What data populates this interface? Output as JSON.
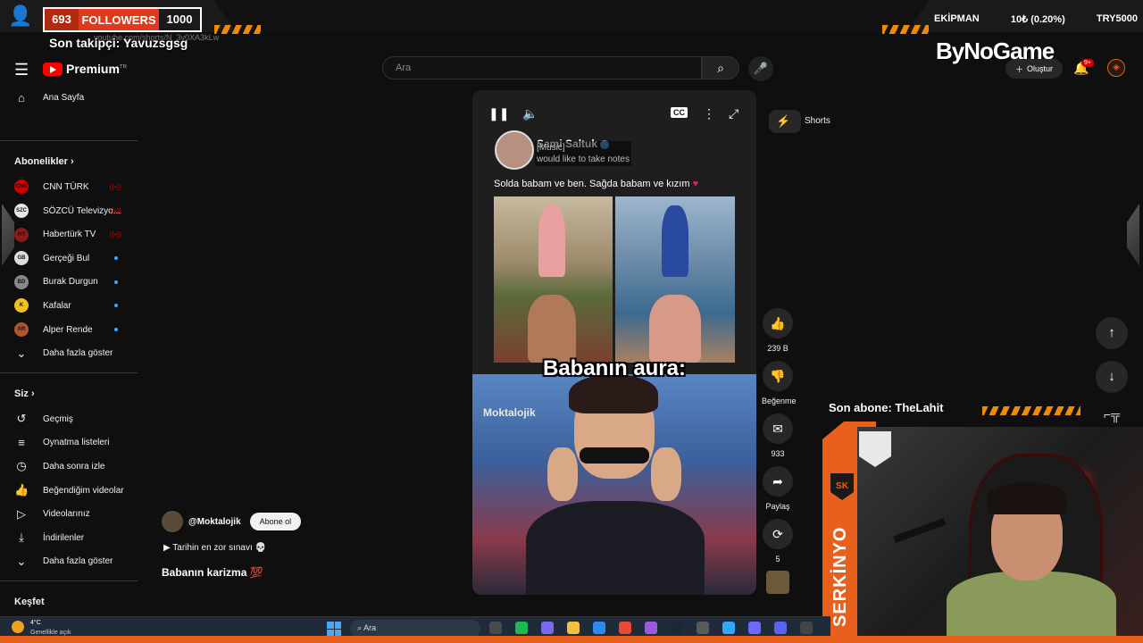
{
  "overlay": {
    "followers_count": "693",
    "followers_label": "FOLLOWERS",
    "followers_goal": "1000",
    "equipment_label": "EKİPMAN",
    "equipment_value": "10₺ (0.20%)",
    "equipment_target": "TRY5000",
    "last_follower": "Son takipçi: Yavuzsgsg",
    "last_subscriber": "Son abone: TheLahit",
    "sponsor": "ByNoGame",
    "streamer_name": "SERKİNYO"
  },
  "browser": {
    "url": "youtube.com/shorts/N_3v0XA3kLw"
  },
  "header": {
    "logo_text": "Premium",
    "logo_region": "TR",
    "search_placeholder": "Ara",
    "create_label": "Oluştur",
    "notif_badge": "9+"
  },
  "sidebar": {
    "main": [
      {
        "label": "Ana Sayfa",
        "icon": "home-icon"
      },
      {
        "label": "Shorts",
        "icon": "shorts-icon",
        "active": true
      }
    ],
    "subs_title": "Abonelikler",
    "subs": [
      {
        "label": "CNN TÜRK",
        "badge": "CNN",
        "color": "#cc0000",
        "live": true
      },
      {
        "label": "SÖZCÜ Televizyo...",
        "badge": "SZC",
        "color": "#e8e8e8",
        "live": true
      },
      {
        "label": "Habertürk TV",
        "badge": "HT",
        "color": "#8b1a1a",
        "live": true
      },
      {
        "label": "Gerçeği Bul",
        "badge": "GB",
        "color": "#dddddd",
        "new": true
      },
      {
        "label": "Burak Durgun",
        "badge": "BD",
        "color": "#888888",
        "new": true
      },
      {
        "label": "Kafalar",
        "badge": "K",
        "color": "#f0c020",
        "new": true
      },
      {
        "label": "Alper Rende",
        "badge": "AR",
        "color": "#aa5533",
        "new": true
      }
    ],
    "subs_more": "Daha fazla göster",
    "you_title": "Siz",
    "you": [
      {
        "label": "Geçmiş",
        "icon": "history-icon"
      },
      {
        "label": "Oynatma listeleri",
        "icon": "playlist-icon"
      },
      {
        "label": "Daha sonra izle",
        "icon": "watch-later-icon"
      },
      {
        "label": "Beğendiğim videolar",
        "icon": "like-icon"
      },
      {
        "label": "Videolarınız",
        "icon": "video-icon"
      },
      {
        "label": "İndirilenler",
        "icon": "download-icon"
      }
    ],
    "you_more": "Daha fazla göster",
    "explore_title": "Keşfet"
  },
  "short": {
    "post_author": "Sami Saltuk",
    "music_caption_line1": "[Music]",
    "music_caption_line2": "would like to take notes",
    "post_text": "Solda babam ve ben. Sağda babam ve kızım",
    "overlay_text": "Babanın aura:",
    "watermark": "Moktalojik",
    "channel": "@Moktalojik",
    "subscribe_label": "Abone ol",
    "linked_video": "▶ Tarihin en zor sınavı 💀",
    "title": "Babanın karizma 💯"
  },
  "actions": {
    "likes": "239 B",
    "dislike_label": "Beğenme",
    "comments": "933",
    "share_label": "Paylaş",
    "remix_count": "5"
  },
  "taskbar": {
    "temp": "4°C",
    "condition": "Genellikle açık",
    "search_placeholder": "Ara"
  }
}
